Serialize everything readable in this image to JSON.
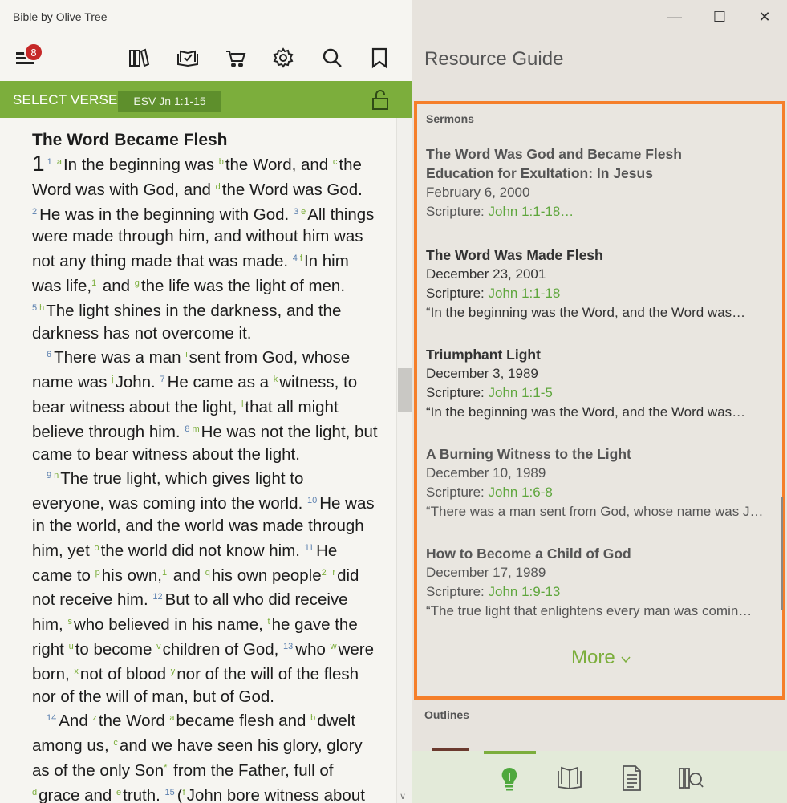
{
  "app": {
    "title": "Bible by Olive Tree",
    "notification_count": "8"
  },
  "verse_bar": {
    "select_label": "SELECT VERSE",
    "reference": "ESV Jn 1:1-15"
  },
  "scripture": {
    "heading": "The Word Became Flesh"
  },
  "resource_guide": {
    "title": "Resource Guide",
    "sermons_label": "Sermons",
    "sermons": [
      {
        "title": "The Word Was God and Became Flesh",
        "subtitle": "Education for Exultation: In Jesus",
        "date": "February 6, 2000",
        "scripture_label": "Scripture: ",
        "scripture_ref": "John 1:1-18…"
      },
      {
        "title": "The Word Was Made Flesh",
        "date": "December 23, 2001",
        "scripture_label": "Scripture: ",
        "scripture_ref": "John 1:1-18",
        "quote": "“In the beginning was the Word, and the Word was…"
      },
      {
        "title": "Triumphant Light",
        "date": "December 3, 1989",
        "scripture_label": "Scripture: ",
        "scripture_ref": "John 1:1-5",
        "quote": "“In the beginning was the Word, and the Word was…"
      },
      {
        "title": "A Burning Witness to the Light",
        "date": "December 10, 1989",
        "scripture_label": "Scripture: ",
        "scripture_ref": "John 1:6-8",
        "quote": "“There was a man sent from God, whose name was J…"
      },
      {
        "title": "How to Become a Child of God",
        "date": "December 17, 1989",
        "scripture_label": "Scripture: ",
        "scripture_ref": "John 1:9-13",
        "quote": "“The true light that enlightens every man was comin…"
      }
    ],
    "more_label": "More",
    "outlines_label": "Outlines"
  },
  "colors": {
    "accent_green": "#7cae3c",
    "highlight_orange": "#f57f2a",
    "badge_red": "#c62828"
  }
}
